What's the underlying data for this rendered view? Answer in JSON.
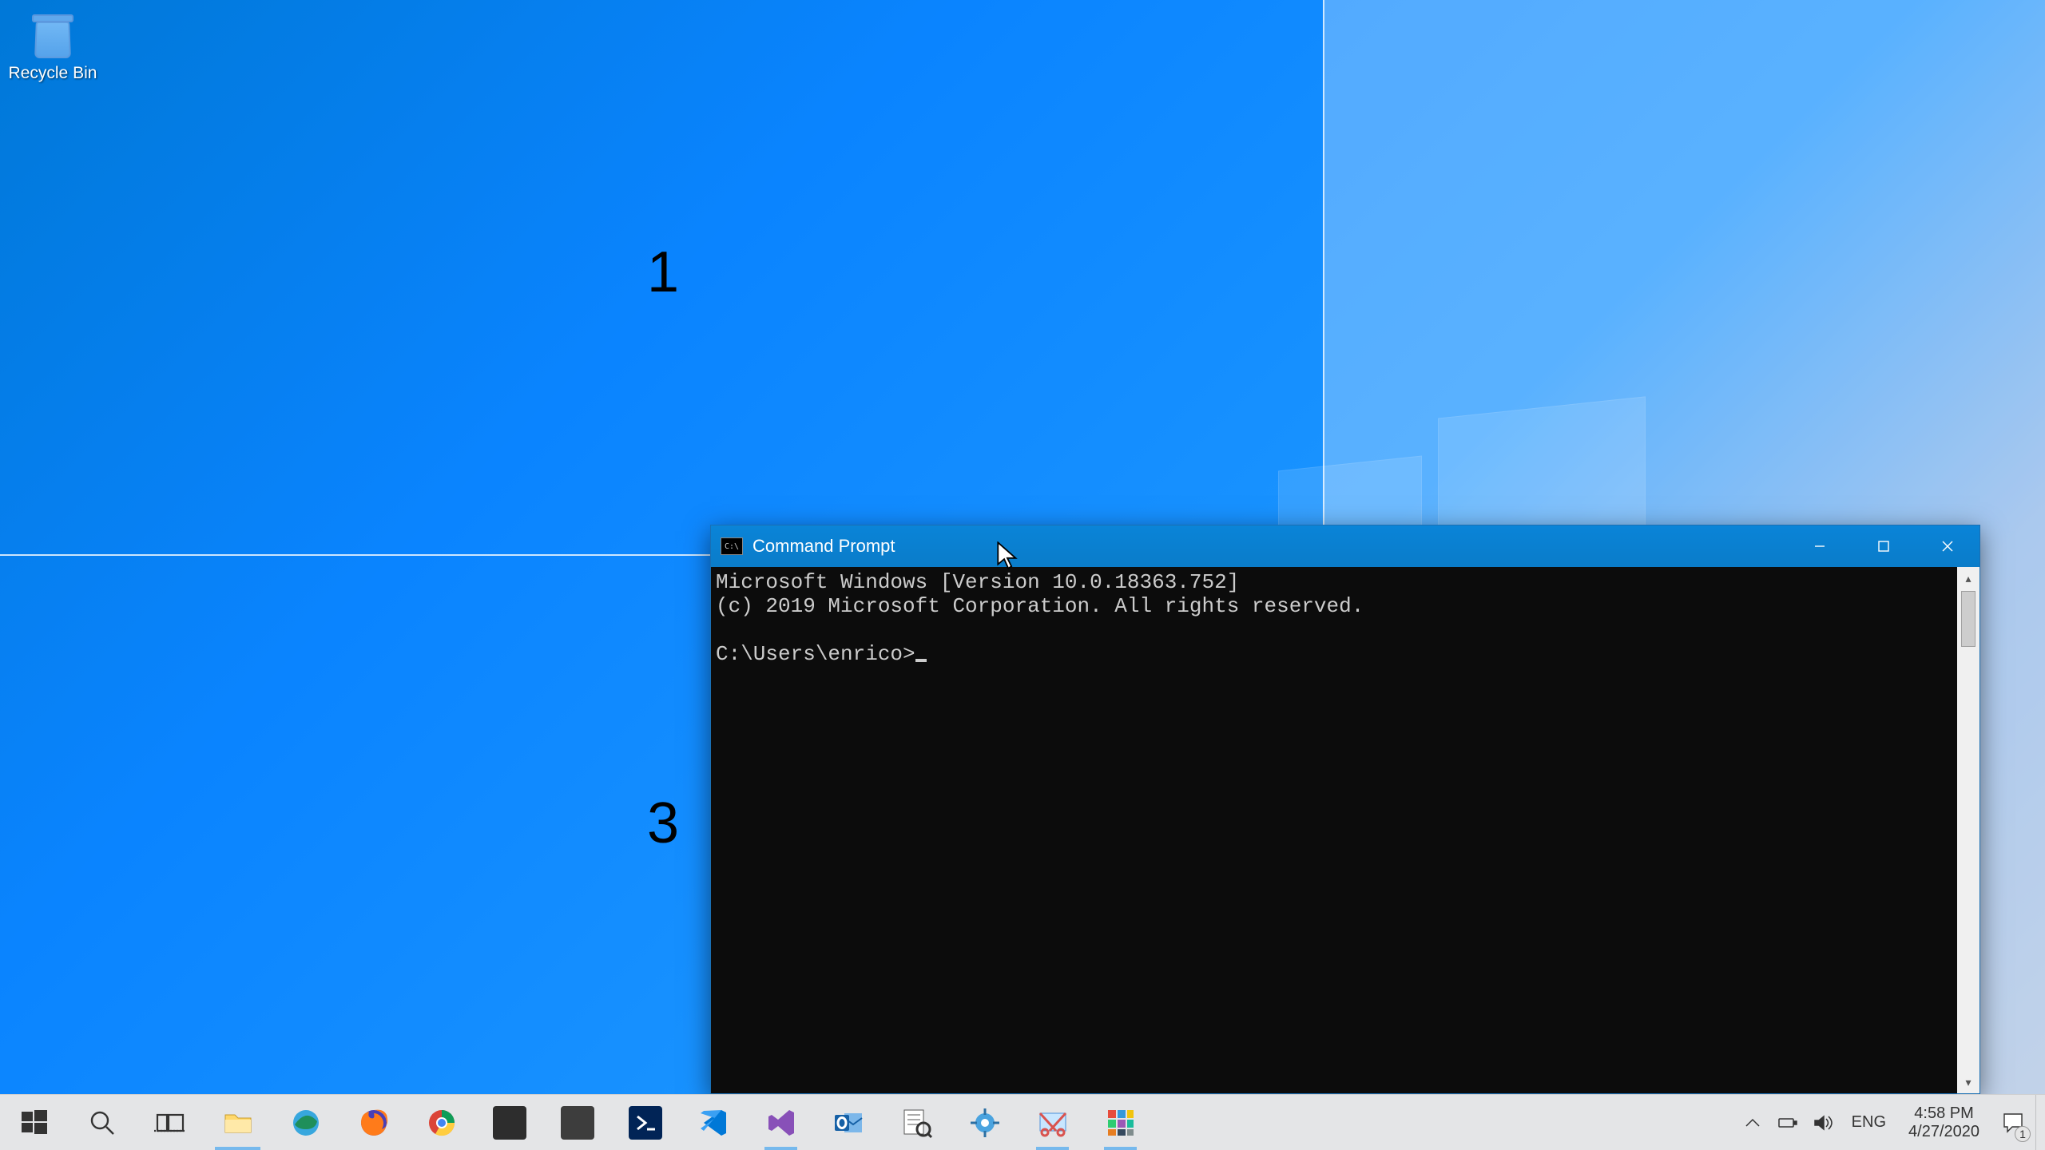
{
  "desktop": {
    "recycle_bin_label": "Recycle Bin",
    "zones": {
      "num1": "1",
      "num3": "3"
    }
  },
  "cmd": {
    "title": "Command Prompt",
    "line1": "Microsoft Windows [Version 10.0.18363.752]",
    "line2": "(c) 2019 Microsoft Corporation. All rights reserved.",
    "prompt": "C:\\Users\\enrico>"
  },
  "taskbar": {
    "tray": {
      "lang": "ENG",
      "time": "4:58 PM",
      "date": "4/27/2020",
      "action_center_badge": "1"
    }
  }
}
